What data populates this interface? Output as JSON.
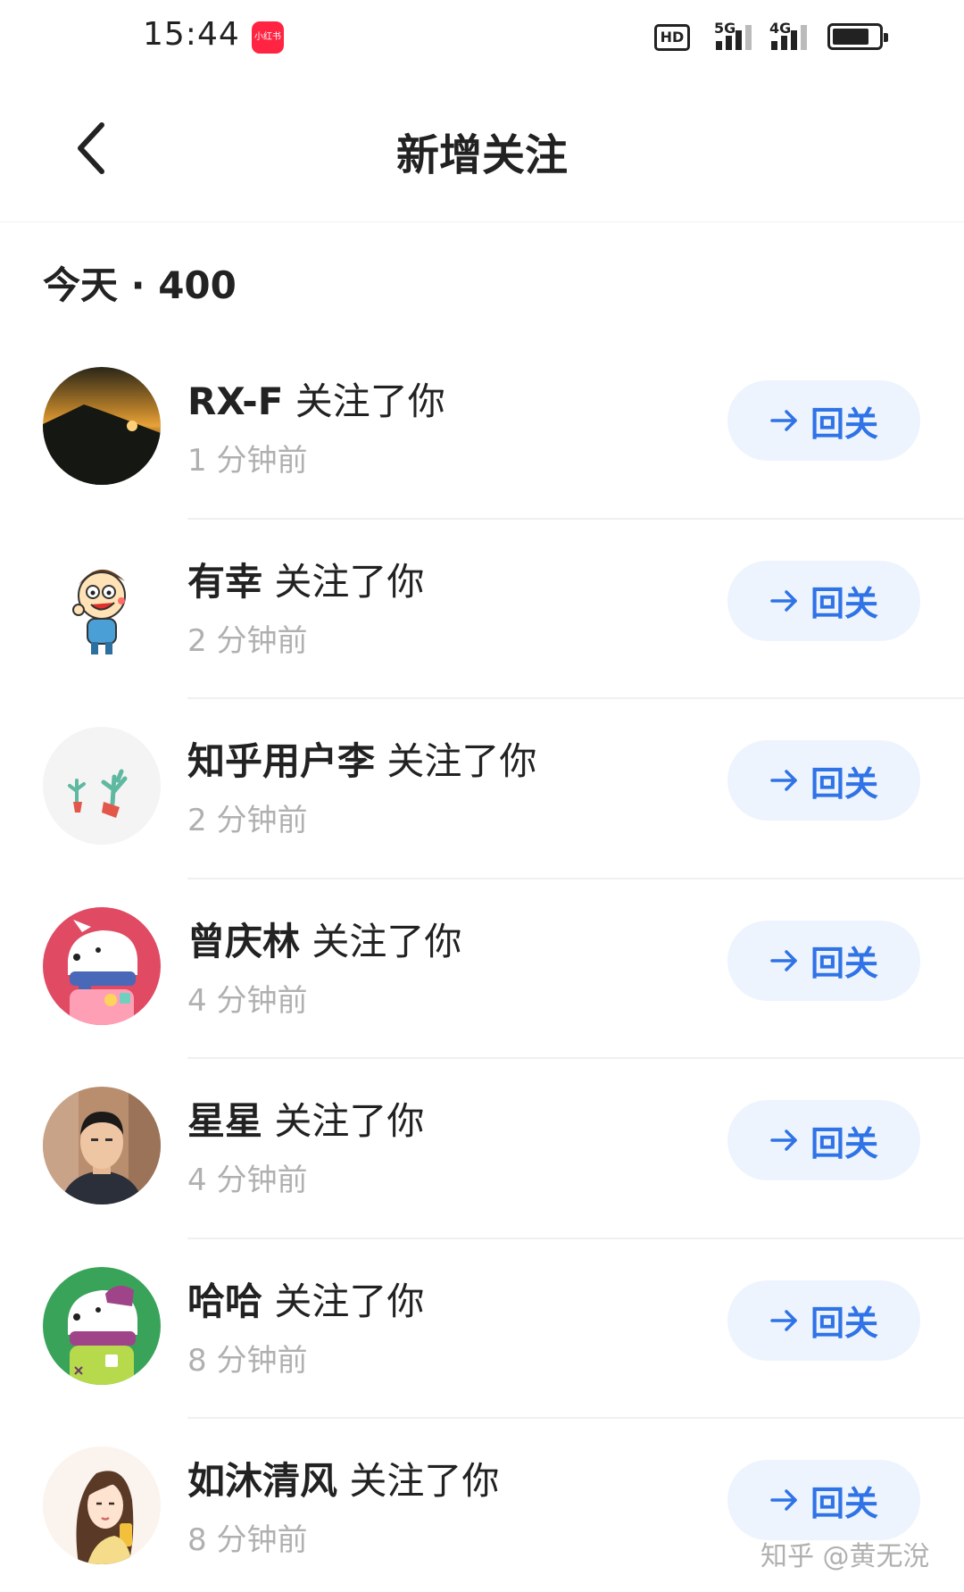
{
  "status_bar": {
    "time": "15:44",
    "app_badge": "小红书",
    "hd_label": "HD",
    "net_primary": "5G",
    "net_secondary": "4G"
  },
  "header": {
    "back_icon": "chevron-left-icon",
    "title": "新增关注"
  },
  "section": {
    "label": "今天 · 400"
  },
  "follow_button_label": "回关",
  "colors": {
    "button_bg": "#edf4fe",
    "button_text": "#2f73e6",
    "time_text": "#b0b0b0"
  },
  "followers": [
    {
      "name": "RX-F",
      "action": "关注了你",
      "time": "1 分钟前",
      "avatar": "sunset-landscape"
    },
    {
      "name": "有幸",
      "action": "关注了你",
      "time": "2 分钟前",
      "avatar": "cartoon-boy"
    },
    {
      "name": "知乎用户李",
      "action": "关注了你",
      "time": "2 分钟前",
      "avatar": "cactus-plants"
    },
    {
      "name": "曾庆林",
      "action": "关注了你",
      "time": "4 分钟前",
      "avatar": "red-cartoon-dog"
    },
    {
      "name": "星星",
      "action": "关注了你",
      "time": "4 分钟前",
      "avatar": "man-photo"
    },
    {
      "name": "哈哈",
      "action": "关注了你",
      "time": "8 分钟前",
      "avatar": "green-cartoon-dog"
    },
    {
      "name": "如沐清风",
      "action": "关注了你",
      "time": "8 分钟前",
      "avatar": "anime-girl"
    }
  ],
  "watermark": "知乎 @黄无涗"
}
